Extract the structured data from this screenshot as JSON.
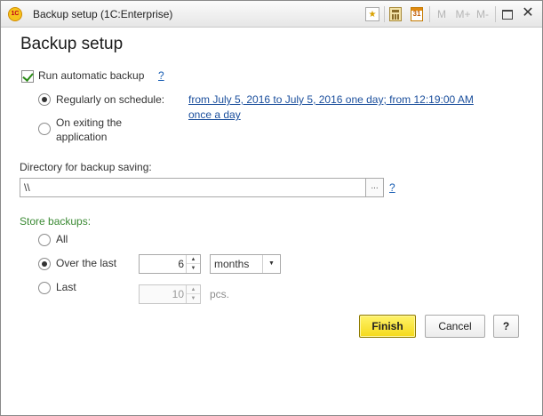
{
  "window": {
    "title": "Backup setup  (1C:Enterprise)",
    "app_logo_text": "1C",
    "toolbar": {
      "m": "M",
      "m_plus": "M+",
      "m_minus": "M-",
      "calendar_day": "31",
      "close": "✕"
    }
  },
  "page": {
    "title": "Backup setup"
  },
  "auto_backup": {
    "label": "Run automatic backup",
    "checked": true,
    "help": "?"
  },
  "schedule": {
    "regularly_label": "Regularly on schedule:",
    "on_exit_label_line1": "On exiting the",
    "on_exit_label_line2": "application",
    "schedule_link_line1": "from July 5, 2016 to July 5, 2016 one day; from 12:19:00 AM",
    "schedule_link_line2": "once a day",
    "selected": "regularly"
  },
  "directory": {
    "label": "Directory for backup saving:",
    "value": "\\\\",
    "select_button": "...",
    "help": "?"
  },
  "store": {
    "label": "Store backups:",
    "options": {
      "all": "All",
      "over_the_last": "Over the last",
      "last": "Last"
    },
    "selected": "over_the_last",
    "period_value": "6",
    "period_unit": "months",
    "count_value": "10",
    "count_unit": "pcs."
  },
  "buttons": {
    "finish": "Finish",
    "cancel": "Cancel",
    "help": "?"
  },
  "colors": {
    "accent_green": "#3b8a34",
    "link_blue": "#1a4e9c",
    "finish_yellow": "#f5d91a"
  }
}
